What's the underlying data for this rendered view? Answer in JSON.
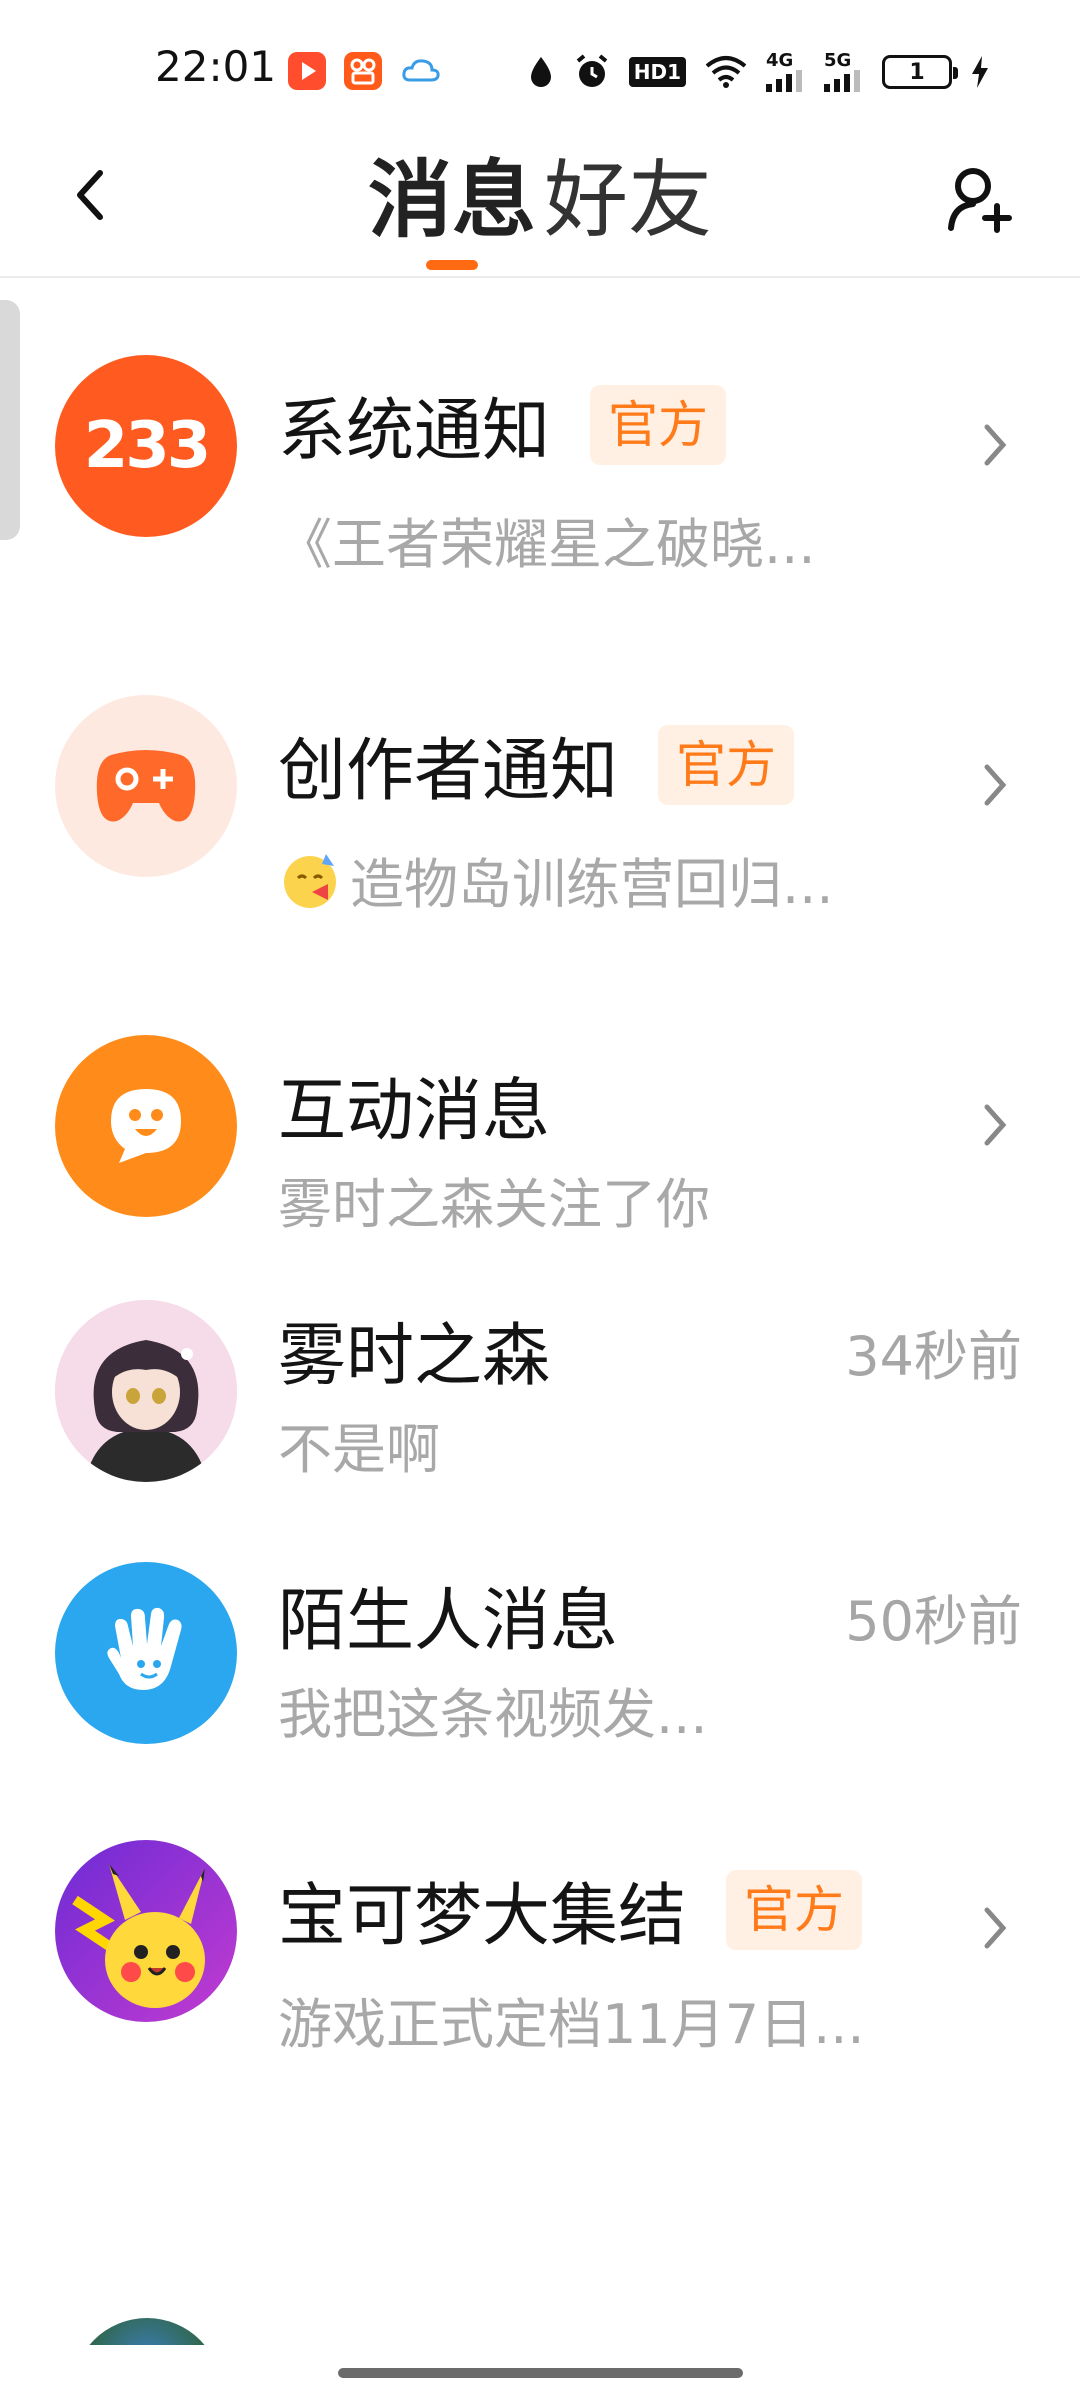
{
  "status_bar": {
    "time": "22:01",
    "hd_label": "HD1",
    "net_4g": "4G",
    "net_5g": "5G",
    "battery_level": "1"
  },
  "header": {
    "tabs": [
      {
        "label": "消息",
        "active": true
      },
      {
        "label": "好友",
        "active": false
      }
    ],
    "accent_color": "#ff6a13"
  },
  "conversations": [
    {
      "title": "系统通知",
      "badge": "官方",
      "subtitle": "《王者荣耀星之破晓...",
      "avatar_text": "233",
      "avatar_color": "#ff5a1f",
      "has_chevron": true
    },
    {
      "title": "创作者通知",
      "badge": "官方",
      "subtitle": "造物岛训练营回归...",
      "avatar_color": "#fde9e0",
      "has_chevron": true
    },
    {
      "title": "互动消息",
      "subtitle": "雾时之森关注了你",
      "avatar_color": "#ff8c1a",
      "has_chevron": true
    },
    {
      "title": "雾时之森",
      "subtitle": "不是啊",
      "time": "34秒前"
    },
    {
      "title": "陌生人消息",
      "subtitle": "我把这条视频发...",
      "time": "50秒前",
      "avatar_color": "#2aa7ee"
    },
    {
      "title": "宝可梦大集结",
      "badge": "官方",
      "subtitle": "游戏正式定档11月7日...",
      "avatar_color": "#7b3fd1",
      "has_chevron": true
    }
  ]
}
